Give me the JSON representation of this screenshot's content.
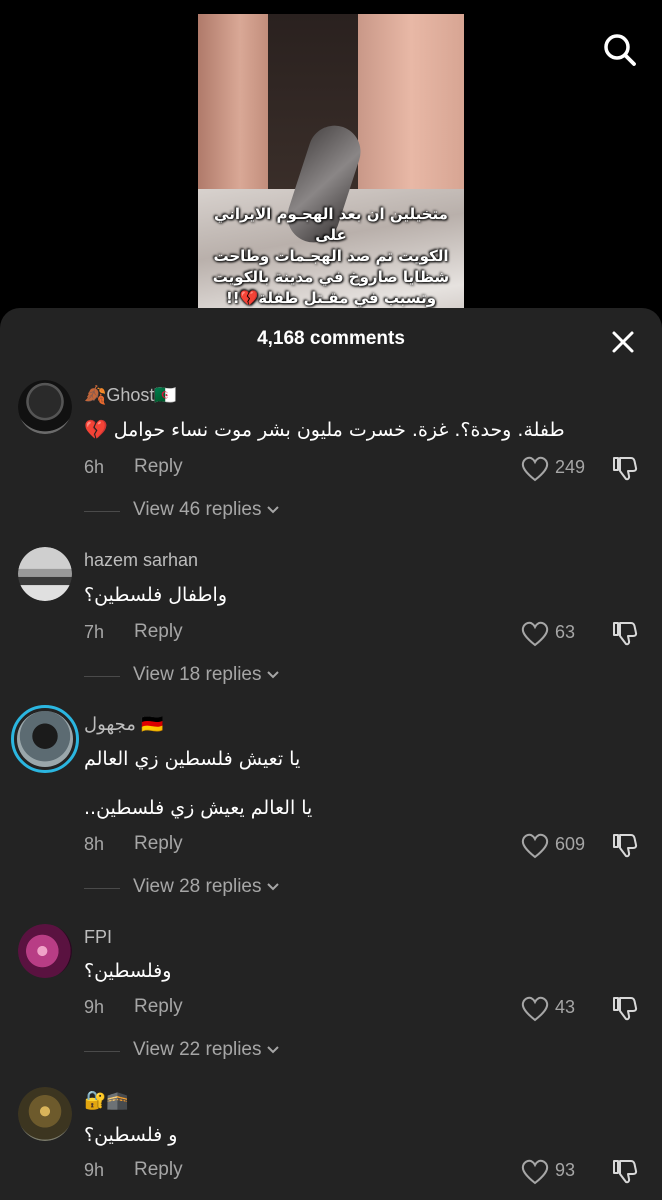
{
  "video": {
    "caption_lines": [
      "متخيلين ان بعد الهجـوم الايراني على",
      "الكويت تم صد الهجـمات وطاحت",
      "شظايا صاروخ في مدينة بالكويت",
      "وتسبب في مقـتل طفلة💔!!"
    ],
    "search_icon": "search-icon"
  },
  "sheet": {
    "count_label": "4,168 comments",
    "close_icon": "close-icon"
  },
  "comments": [
    {
      "username": "🍂Ghost🇩🇿",
      "lines": [
        "طفلة. وحدة؟. غزة. خسرت مليون بشر موت نساء حوامل 💔"
      ],
      "time": "6h",
      "reply": "Reply",
      "likes": "249",
      "view_replies": "View 46 replies"
    },
    {
      "username": "hazem sarhan",
      "lines": [
        "واطفال فلسطين؟"
      ],
      "time": "7h",
      "reply": "Reply",
      "likes": "63",
      "view_replies": "View 18 replies"
    },
    {
      "username": "مجهول 🇩🇪",
      "lines": [
        "يا تعيش فلسطين زي العالم",
        "يا العالم يعيش زي فلسطين.."
      ],
      "time": "8h",
      "reply": "Reply",
      "likes": "609",
      "view_replies": "View 28 replies"
    },
    {
      "username": "FPI",
      "lines": [
        "وفلسطين؟"
      ],
      "time": "9h",
      "reply": "Reply",
      "likes": "43",
      "view_replies": "View 22 replies"
    },
    {
      "username": "🔐🕋",
      "lines": [
        "و فلسطين؟"
      ],
      "time": "9h",
      "reply": "Reply",
      "likes": "93",
      "view_replies": ""
    }
  ],
  "colors": {
    "sheet_bg": "#232323",
    "secondary_text": "#a6a6a6",
    "story_ring": "#2bb6e0"
  }
}
